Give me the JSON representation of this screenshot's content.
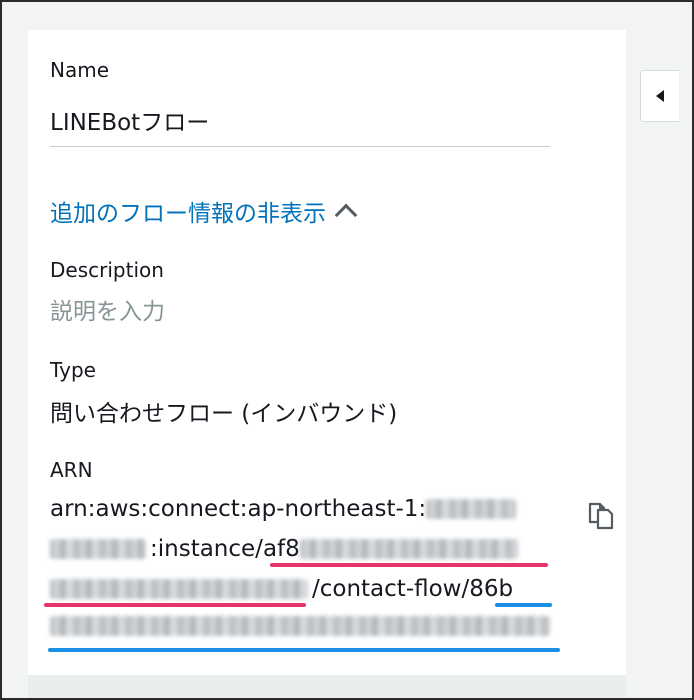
{
  "name_field": {
    "label": "Name",
    "value": "LINEBotフロー"
  },
  "toggle": {
    "label": "追加のフロー情報の非表示",
    "icon": "chevron-up-icon"
  },
  "description": {
    "label": "Description",
    "placeholder": "説明を入力"
  },
  "type_field": {
    "label": "Type",
    "value": "問い合わせフロー (インバウンド)"
  },
  "arn_field": {
    "label": "ARN",
    "prefix": "arn:aws:connect:ap-northeast-1:",
    "instance_segment": ":instance/",
    "instance_id_start": "af8",
    "flow_segment": "/contact-flow/",
    "flow_id_start": "86b",
    "copy_icon": "copy-icon"
  },
  "colors": {
    "link": "#0073bb",
    "highlight_instance": "#e8336b",
    "highlight_flow": "#1a8fe3"
  }
}
